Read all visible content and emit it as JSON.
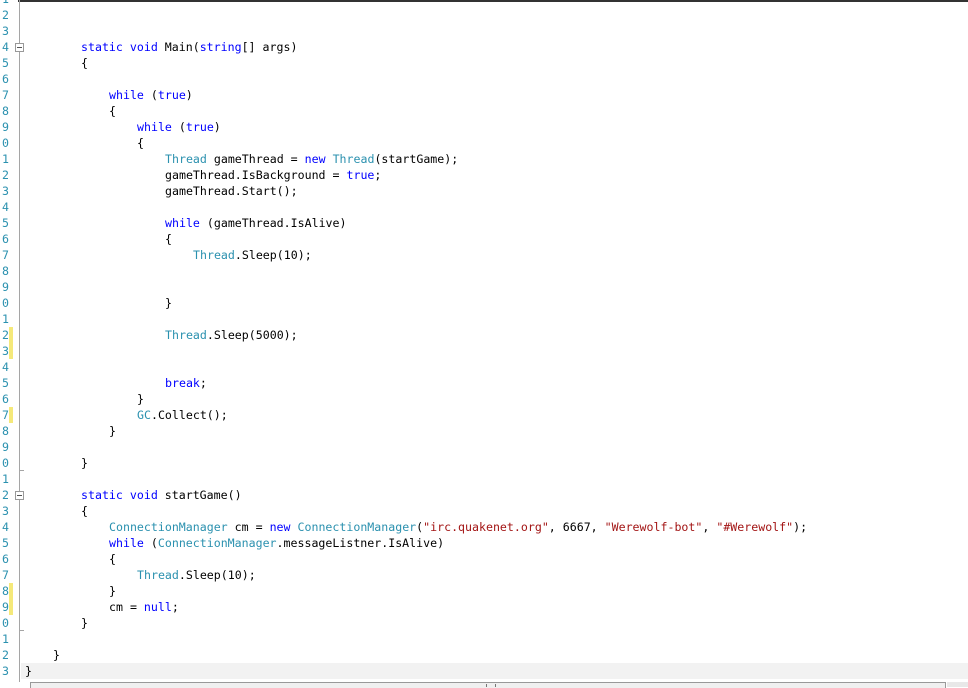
{
  "editor": {
    "colors": {
      "keyword": "#0000ff",
      "type": "#2b91af",
      "string": "#a31515",
      "line_number": "#2b91af",
      "change_marker": "#f5e97a"
    },
    "line_number_digits": [
      "1",
      "2",
      "3",
      "4",
      "5",
      "6",
      "7",
      "8",
      "9",
      "0",
      "1",
      "2",
      "3",
      "4",
      "5",
      "6",
      "7",
      "8",
      "9",
      "0",
      "1",
      "2",
      "3",
      "4",
      "5",
      "6",
      "7",
      "8",
      "9",
      "0",
      "1",
      "2",
      "3",
      "4",
      "5",
      "6",
      "7",
      "8",
      "9",
      "0",
      "1",
      "2",
      "3"
    ],
    "changed_lines": [
      22,
      23,
      27,
      38,
      39
    ],
    "fold_lines": [
      4,
      32
    ],
    "lines": [
      {
        "n": 4,
        "indent": 2,
        "tokens": [
          [
            "kw",
            "static"
          ],
          [
            "tx",
            " "
          ],
          [
            "kw",
            "void"
          ],
          [
            "tx",
            " Main("
          ],
          [
            "kw",
            "string"
          ],
          [
            "tx",
            "[] args)"
          ]
        ]
      },
      {
        "n": 5,
        "indent": 2,
        "tokens": [
          [
            "tx",
            "{"
          ]
        ]
      },
      {
        "n": 7,
        "indent": 3,
        "tokens": [
          [
            "kw",
            "while"
          ],
          [
            "tx",
            " ("
          ],
          [
            "kw",
            "true"
          ],
          [
            "tx",
            ")"
          ]
        ]
      },
      {
        "n": 8,
        "indent": 3,
        "tokens": [
          [
            "tx",
            "{"
          ]
        ]
      },
      {
        "n": 9,
        "indent": 4,
        "tokens": [
          [
            "kw",
            "while"
          ],
          [
            "tx",
            " ("
          ],
          [
            "kw",
            "true"
          ],
          [
            "tx",
            ")"
          ]
        ]
      },
      {
        "n": 10,
        "indent": 4,
        "tokens": [
          [
            "tx",
            "{"
          ]
        ]
      },
      {
        "n": 11,
        "indent": 5,
        "tokens": [
          [
            "ty",
            "Thread"
          ],
          [
            "tx",
            " gameThread = "
          ],
          [
            "kw",
            "new"
          ],
          [
            "tx",
            " "
          ],
          [
            "ty",
            "Thread"
          ],
          [
            "tx",
            "(startGame);"
          ]
        ]
      },
      {
        "n": 12,
        "indent": 5,
        "tokens": [
          [
            "tx",
            "gameThread.IsBackground = "
          ],
          [
            "kw",
            "true"
          ],
          [
            "tx",
            ";"
          ]
        ]
      },
      {
        "n": 13,
        "indent": 5,
        "tokens": [
          [
            "tx",
            "gameThread.Start();"
          ]
        ]
      },
      {
        "n": 15,
        "indent": 5,
        "tokens": [
          [
            "kw",
            "while"
          ],
          [
            "tx",
            " (gameThread.IsAlive)"
          ]
        ]
      },
      {
        "n": 16,
        "indent": 5,
        "tokens": [
          [
            "tx",
            "{"
          ]
        ]
      },
      {
        "n": 17,
        "indent": 6,
        "tokens": [
          [
            "ty",
            "Thread"
          ],
          [
            "tx",
            ".Sleep(10);"
          ]
        ]
      },
      {
        "n": 20,
        "indent": 5,
        "tokens": [
          [
            "tx",
            "}"
          ]
        ]
      },
      {
        "n": 22,
        "indent": 5,
        "tokens": [
          [
            "ty",
            "Thread"
          ],
          [
            "tx",
            ".Sleep(5000);"
          ]
        ]
      },
      {
        "n": 25,
        "indent": 5,
        "tokens": [
          [
            "kw",
            "break"
          ],
          [
            "tx",
            ";"
          ]
        ]
      },
      {
        "n": 26,
        "indent": 4,
        "tokens": [
          [
            "tx",
            "}"
          ]
        ]
      },
      {
        "n": 27,
        "indent": 4,
        "tokens": [
          [
            "ty",
            "GC"
          ],
          [
            "tx",
            ".Collect();"
          ]
        ]
      },
      {
        "n": 28,
        "indent": 3,
        "tokens": [
          [
            "tx",
            "}"
          ]
        ]
      },
      {
        "n": 30,
        "indent": 2,
        "tokens": [
          [
            "tx",
            "}"
          ]
        ]
      },
      {
        "n": 32,
        "indent": 2,
        "tokens": [
          [
            "kw",
            "static"
          ],
          [
            "tx",
            " "
          ],
          [
            "kw",
            "void"
          ],
          [
            "tx",
            " startGame()"
          ]
        ]
      },
      {
        "n": 33,
        "indent": 2,
        "tokens": [
          [
            "tx",
            "{"
          ]
        ]
      },
      {
        "n": 34,
        "indent": 3,
        "tokens": [
          [
            "ty",
            "ConnectionManager"
          ],
          [
            "tx",
            " cm = "
          ],
          [
            "kw",
            "new"
          ],
          [
            "tx",
            " "
          ],
          [
            "ty",
            "ConnectionManager"
          ],
          [
            "tx",
            "("
          ],
          [
            "st",
            "\"irc.quakenet.org\""
          ],
          [
            "tx",
            ", 6667, "
          ],
          [
            "st",
            "\"Werewolf-bot\""
          ],
          [
            "tx",
            ", "
          ],
          [
            "st",
            "\"#Werewolf\""
          ],
          [
            "tx",
            ");"
          ]
        ]
      },
      {
        "n": 35,
        "indent": 3,
        "tokens": [
          [
            "kw",
            "while"
          ],
          [
            "tx",
            " ("
          ],
          [
            "ty",
            "ConnectionManager"
          ],
          [
            "tx",
            ".messageListner.IsAlive)"
          ]
        ]
      },
      {
        "n": 36,
        "indent": 3,
        "tokens": [
          [
            "tx",
            "{"
          ]
        ]
      },
      {
        "n": 37,
        "indent": 4,
        "tokens": [
          [
            "ty",
            "Thread"
          ],
          [
            "tx",
            ".Sleep(10);"
          ]
        ]
      },
      {
        "n": 38,
        "indent": 3,
        "tokens": [
          [
            "tx",
            "}"
          ]
        ]
      },
      {
        "n": 39,
        "indent": 3,
        "tokens": [
          [
            "tx",
            "cm = "
          ],
          [
            "kw",
            "null"
          ],
          [
            "tx",
            ";"
          ]
        ]
      },
      {
        "n": 40,
        "indent": 2,
        "tokens": [
          [
            "tx",
            "}"
          ]
        ]
      },
      {
        "n": 42,
        "indent": 1,
        "tokens": [
          [
            "tx",
            "}"
          ]
        ]
      },
      {
        "n": 43,
        "indent": 0,
        "tokens": [
          [
            "tx",
            "}"
          ]
        ]
      }
    ]
  }
}
